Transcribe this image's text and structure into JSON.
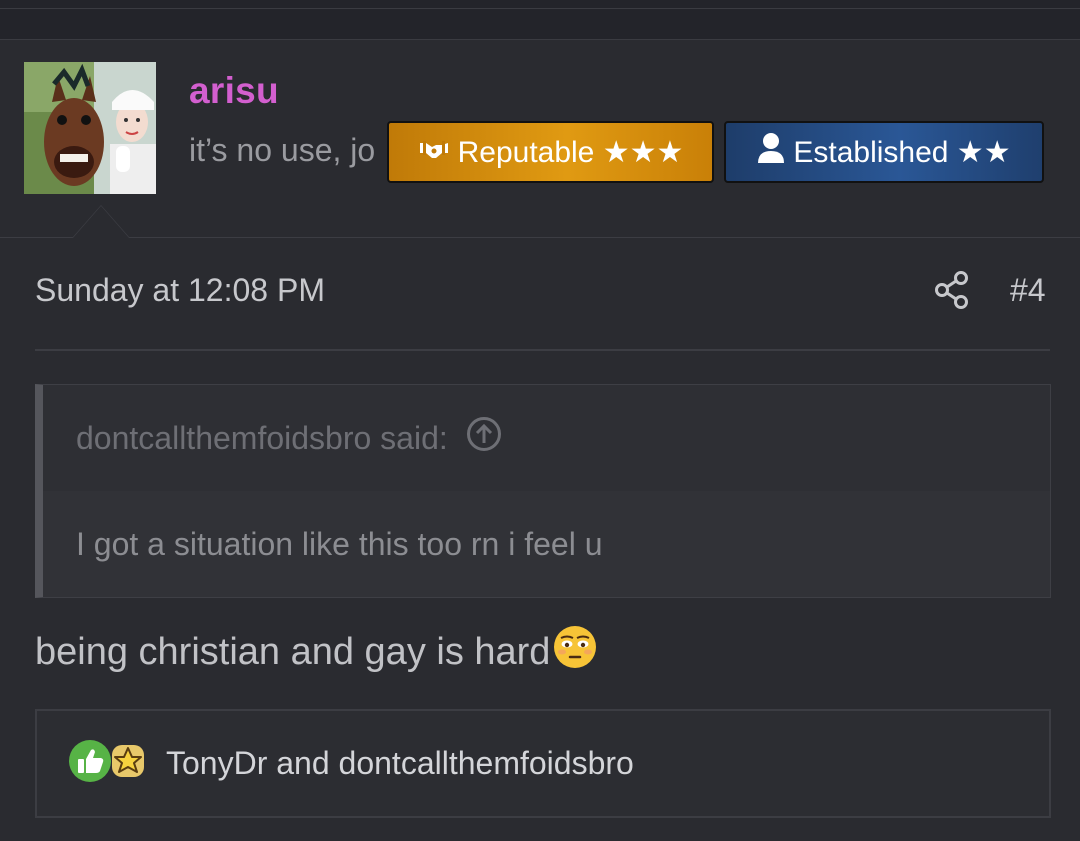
{
  "user": {
    "name": "arisu",
    "title": "it’s no use, jo",
    "name_color": "#d35fcf",
    "avatar_icon": "avatar-image"
  },
  "badges": [
    {
      "label": "Reputable ★★★",
      "icon": "handshake-icon",
      "color": "#e09a12"
    },
    {
      "label": "Established ★★",
      "icon": "user-icon",
      "color": "#2a5796"
    }
  ],
  "post": {
    "date": "Sunday at 12:08 PM",
    "number": "#4",
    "share_icon": "share-icon",
    "message": "being christian and gay is hard",
    "message_emoji": "flushed-face-emoji"
  },
  "quote": {
    "author_line": "dontcallthemfoidsbro said:",
    "jump_icon": "arrow-up-circle-icon",
    "text": "I got a situation like this too rn i feel u"
  },
  "reactions": {
    "icons": [
      "like-icon",
      "star-icon"
    ],
    "text": "TonyDr and dontcallthemfoidsbro"
  }
}
